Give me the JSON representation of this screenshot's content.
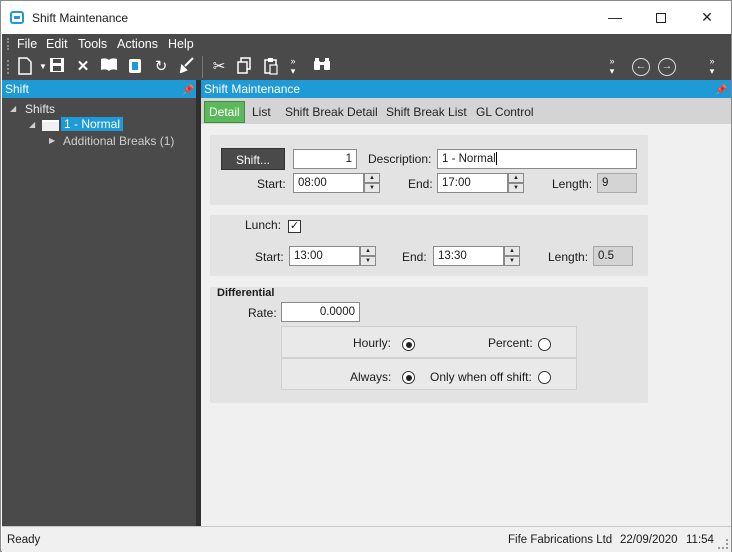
{
  "window": {
    "title": "Shift Maintenance",
    "min_glyph": "—",
    "close_glyph": "✕"
  },
  "menu": [
    "File",
    "Edit",
    "Tools",
    "Actions",
    "Help"
  ],
  "toolbar": {
    "icons": [
      "new-document-icon",
      "save-icon",
      "delete-icon",
      "book-icon",
      "database-icon",
      "refresh-icon",
      "clear-icon",
      "cut-icon",
      "copy-icon",
      "paste-icon",
      "binoculars-icon",
      "back-icon",
      "forward-icon"
    ]
  },
  "left_panel": {
    "title": "Shift",
    "tree": {
      "root": "Shifts",
      "child": "1 - Normal",
      "grandchild": "Additional Breaks (1)"
    }
  },
  "main_panel": {
    "title": "Shift Maintenance",
    "tabs": [
      "Detail",
      "List",
      "Shift Break Detail",
      "Shift Break List",
      "GL Control"
    ],
    "active_tab": "Detail"
  },
  "shift": {
    "button_label": "Shift...",
    "id_value": "1",
    "description_label": "Description:",
    "description_value": "1 - Normal",
    "start_label": "Start:",
    "start_value": "08:00",
    "end_label": "End:",
    "end_value": "17:00",
    "length_label": "Length:",
    "length_value": "9"
  },
  "lunch": {
    "label": "Lunch:",
    "checked": true,
    "start_label": "Start:",
    "start_value": "13:00",
    "end_label": "End:",
    "end_value": "13:30",
    "length_label": "Length:",
    "length_value": "0.5"
  },
  "differential": {
    "heading": "Differential",
    "rate_label": "Rate:",
    "rate_value": "0.0000",
    "hourly_label": "Hourly:",
    "percent_label": "Percent:",
    "always_label": "Always:",
    "only_off_shift_label": "Only when off shift:",
    "selected_type": "Hourly",
    "selected_when": "Always"
  },
  "status": {
    "left": "Ready",
    "company": "Fife Fabrications Ltd",
    "date": "22/09/2020",
    "time": "11:54"
  },
  "colors": {
    "accent": "#1e9ad6",
    "active_tab": "#5cb85c",
    "dark_panel": "#4a4a4a"
  }
}
